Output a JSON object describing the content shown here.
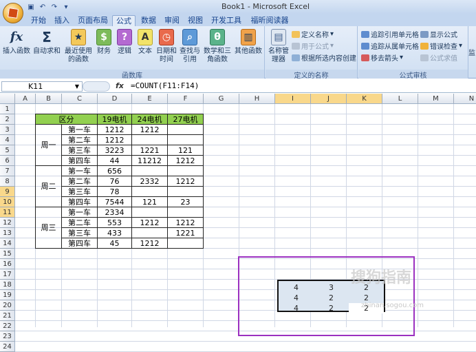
{
  "window": {
    "title": "Book1 - Microsoft Excel"
  },
  "tabs": [
    "开始",
    "插入",
    "页面布局",
    "公式",
    "数据",
    "审阅",
    "视图",
    "开发工具",
    "福昕阅读器"
  ],
  "active_tab": "公式",
  "ribbon": {
    "groups": [
      {
        "name": "函数库",
        "buttons": [
          "插入函数",
          "自动求和",
          "最近使用的函数",
          "财务",
          "逻辑",
          "文本",
          "日期和时间",
          "查找与引用",
          "数学和三角函数",
          "其他函数"
        ]
      },
      {
        "name": "定义的名称",
        "big": "名称管理器",
        "small": [
          "定义名称",
          "用于公式",
          "根据所选内容创建"
        ]
      },
      {
        "name": "公式审核",
        "small": [
          "追踪引用单元格",
          "追踪从属单元格",
          "移去箭头",
          "显示公式",
          "错误检查",
          "公式求值"
        ],
        "extra": "监"
      }
    ]
  },
  "formula_bar": {
    "name_box": "K11",
    "fx": "fx",
    "formula": "=COUNT(F11:F14)"
  },
  "columns": [
    "A",
    "B",
    "C",
    "D",
    "E",
    "F",
    "G",
    "H",
    "I",
    "J",
    "K",
    "L",
    "M",
    "N"
  ],
  "rows": [
    "1",
    "2",
    "3",
    "4",
    "5",
    "6",
    "7",
    "8",
    "9",
    "10",
    "11",
    "12",
    "13",
    "14",
    "15",
    "16",
    "17",
    "18",
    "19",
    "20",
    "21",
    "22",
    "23",
    "24"
  ],
  "table": {
    "header": [
      "区分",
      "19电机",
      "24电机",
      "27电机"
    ],
    "groups": [
      {
        "label": "周一",
        "rows": [
          [
            "第一车",
            "1212",
            "1212",
            ""
          ],
          [
            "第二车",
            "1212",
            "",
            ""
          ],
          [
            "第三车",
            "3223",
            "1221",
            "121"
          ],
          [
            "第四车",
            "44",
            "11212",
            "1212"
          ]
        ]
      },
      {
        "label": "周二",
        "rows": [
          [
            "第一车",
            "656",
            "",
            ""
          ],
          [
            "第二车",
            "76",
            "2332",
            "1212"
          ],
          [
            "第三车",
            "78",
            "",
            ""
          ],
          [
            "第四车",
            "7544",
            "121",
            "23"
          ]
        ]
      },
      {
        "label": "周三",
        "rows": [
          [
            "第一车",
            "2334",
            "",
            ""
          ],
          [
            "第二车",
            "553",
            "1212",
            "1212"
          ],
          [
            "第三车",
            "433",
            "",
            "1221"
          ],
          [
            "第四车",
            "45",
            "1212",
            ""
          ]
        ]
      }
    ]
  },
  "count_results": [
    [
      "4",
      "3",
      "2"
    ],
    [
      "4",
      "2",
      "2"
    ],
    [
      "4",
      "2",
      "2"
    ]
  ],
  "watermark": {
    "text": "搜狗指南",
    "sub": "zhinan.sogou.com"
  }
}
